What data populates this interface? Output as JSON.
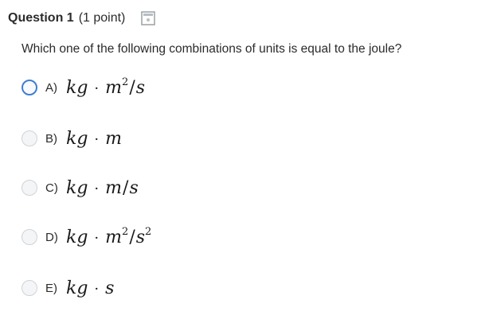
{
  "question": {
    "title": "Question 1",
    "points": "(1 point)",
    "text": "Which one of the following combinations of units is equal to the joule?"
  },
  "options": [
    {
      "letter": "A)",
      "u1": "kg",
      "sep": "·",
      "u2": "m",
      "exp2": "2",
      "slash": "/",
      "u3": "s",
      "exp3": ""
    },
    {
      "letter": "B)",
      "u1": "kg",
      "sep": "·",
      "u2": "m",
      "exp2": "",
      "slash": "",
      "u3": "",
      "exp3": ""
    },
    {
      "letter": "C)",
      "u1": "kg",
      "sep": "·",
      "u2": "m",
      "exp2": "",
      "slash": "/",
      "u3": "s",
      "exp3": ""
    },
    {
      "letter": "D)",
      "u1": "kg",
      "sep": "·",
      "u2": "m",
      "exp2": "2",
      "slash": "/",
      "u3": "s",
      "exp3": "2"
    },
    {
      "letter": "E)",
      "u1": "kg",
      "sep": "·",
      "u2": "s",
      "exp2": "",
      "slash": "",
      "u3": "",
      "exp3": ""
    }
  ],
  "icons": {
    "bookmark": "bookmark-icon",
    "radio": "radio-button-icon"
  },
  "colors": {
    "focus_ring": "#3d7fd2",
    "radio_border": "#cfd3d7",
    "text": "#2b2b2b"
  }
}
